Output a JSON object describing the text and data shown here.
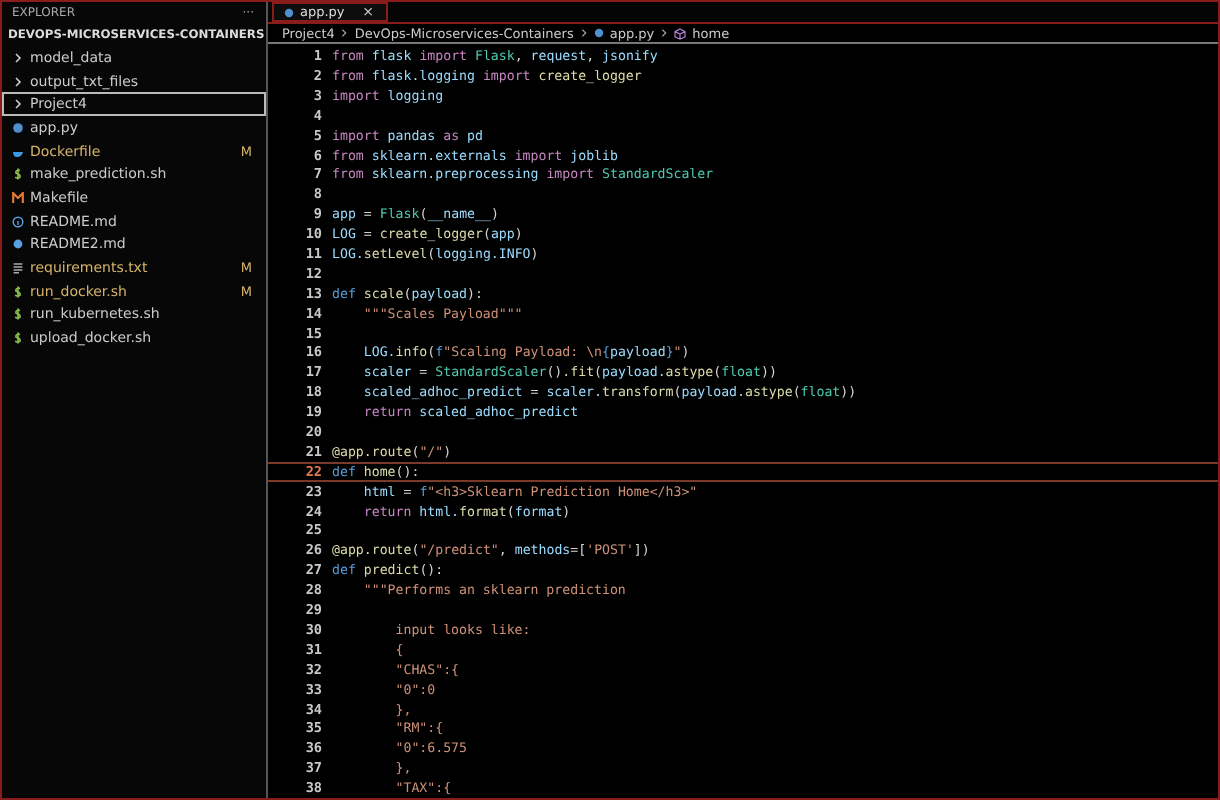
{
  "sidebar": {
    "header": "EXPLORER",
    "more": "···",
    "section": "DEVOPS-MICROSERVICES-CONTAINERS",
    "items": [
      {
        "kind": "folder",
        "label": "model_data",
        "selected": false,
        "modified": false
      },
      {
        "kind": "folder",
        "label": "output_txt_files",
        "selected": false,
        "modified": false
      },
      {
        "kind": "folder",
        "label": "Project4",
        "selected": true,
        "modified": false
      },
      {
        "kind": "python",
        "label": "app.py",
        "selected": false,
        "modified": false
      },
      {
        "kind": "docker",
        "label": "Dockerfile",
        "selected": false,
        "modified": true,
        "badge": "M"
      },
      {
        "kind": "shell",
        "label": "make_prediction.sh",
        "selected": false,
        "modified": false
      },
      {
        "kind": "make",
        "label": "Makefile",
        "selected": false,
        "modified": false
      },
      {
        "kind": "info",
        "label": "README.md",
        "selected": false,
        "modified": false
      },
      {
        "kind": "markdown",
        "label": "README2.md",
        "selected": false,
        "modified": false
      },
      {
        "kind": "text",
        "label": "requirements.txt",
        "selected": false,
        "modified": true,
        "badge": "M"
      },
      {
        "kind": "shell",
        "label": "run_docker.sh",
        "selected": false,
        "modified": true,
        "badge": "M"
      },
      {
        "kind": "shell",
        "label": "run_kubernetes.sh",
        "selected": false,
        "modified": false
      },
      {
        "kind": "shell",
        "label": "upload_docker.sh",
        "selected": false,
        "modified": false
      }
    ]
  },
  "tabs": [
    {
      "label": "app.py",
      "close": "×",
      "selected": true
    }
  ],
  "breadcrumb": [
    {
      "kind": "text",
      "label": "Project4"
    },
    {
      "kind": "text",
      "label": "DevOps-Microservices-Containers"
    },
    {
      "kind": "file",
      "label": "app.py"
    },
    {
      "kind": "symbol",
      "label": "home"
    }
  ],
  "lines": [
    {
      "number": "1",
      "current": false,
      "tokens": [
        {
          "kind": "kw",
          "text": "from "
        },
        {
          "kind": "var",
          "text": "flask "
        },
        {
          "kind": "kw",
          "text": "import "
        },
        {
          "kind": "cls",
          "text": "Flask"
        },
        {
          "kind": "punc",
          "text": ", "
        },
        {
          "kind": "var",
          "text": "request"
        },
        {
          "kind": "punc",
          "text": ", "
        },
        {
          "kind": "var",
          "text": "jsonify"
        }
      ]
    },
    {
      "number": "2",
      "current": false,
      "tokens": [
        {
          "kind": "kw",
          "text": "from "
        },
        {
          "kind": "var",
          "text": "flask.logging "
        },
        {
          "kind": "kw",
          "text": "import "
        },
        {
          "kind": "fn",
          "text": "create_logger"
        }
      ]
    },
    {
      "number": "3",
      "current": false,
      "tokens": [
        {
          "kind": "kw",
          "text": "import "
        },
        {
          "kind": "var",
          "text": "logging"
        }
      ]
    },
    {
      "number": "4",
      "current": false
    },
    {
      "number": "5",
      "current": false,
      "tokens": [
        {
          "kind": "kw",
          "text": "import "
        },
        {
          "kind": "var",
          "text": "pandas "
        },
        {
          "kind": "kw",
          "text": "as "
        },
        {
          "kind": "var",
          "text": "pd"
        }
      ]
    },
    {
      "number": "6",
      "current": false,
      "tokens": [
        {
          "kind": "kw",
          "text": "from "
        },
        {
          "kind": "var",
          "text": "sklearn.externals "
        },
        {
          "kind": "kw",
          "text": "import "
        },
        {
          "kind": "var",
          "text": "joblib"
        }
      ]
    },
    {
      "number": "7",
      "current": false,
      "tokens": [
        {
          "kind": "kw",
          "text": "from "
        },
        {
          "kind": "var",
          "text": "sklearn.preprocessing "
        },
        {
          "kind": "kw",
          "text": "import "
        },
        {
          "kind": "cls",
          "text": "StandardScaler"
        }
      ]
    },
    {
      "number": "8",
      "current": false
    },
    {
      "number": "9",
      "current": false,
      "tokens": [
        {
          "kind": "var",
          "text": "app "
        },
        {
          "kind": "punc",
          "text": "= "
        },
        {
          "kind": "cls",
          "text": "Flask"
        },
        {
          "kind": "punc",
          "text": "("
        },
        {
          "kind": "var",
          "text": "__name__"
        },
        {
          "kind": "punc",
          "text": ")"
        }
      ]
    },
    {
      "number": "10",
      "current": false,
      "tokens": [
        {
          "kind": "var",
          "text": "LOG "
        },
        {
          "kind": "punc",
          "text": "= "
        },
        {
          "kind": "fn",
          "text": "create_logger"
        },
        {
          "kind": "punc",
          "text": "("
        },
        {
          "kind": "var",
          "text": "app"
        },
        {
          "kind": "punc",
          "text": ")"
        }
      ]
    },
    {
      "number": "11",
      "current": false,
      "tokens": [
        {
          "kind": "var",
          "text": "LOG."
        },
        {
          "kind": "fn",
          "text": "setLevel"
        },
        {
          "kind": "punc",
          "text": "("
        },
        {
          "kind": "var",
          "text": "logging.INFO"
        },
        {
          "kind": "punc",
          "text": ")"
        }
      ]
    },
    {
      "number": "12",
      "current": false
    },
    {
      "number": "13",
      "current": false,
      "tokens": [
        {
          "kind": "def",
          "text": "def "
        },
        {
          "kind": "fn",
          "text": "scale"
        },
        {
          "kind": "punc",
          "text": "("
        },
        {
          "kind": "var",
          "text": "payload"
        },
        {
          "kind": "punc",
          "text": "):"
        }
      ]
    },
    {
      "number": "14",
      "current": false,
      "tokens": [
        {
          "kind": "str",
          "text": "    \"\"\"Scales Payload\"\"\""
        }
      ]
    },
    {
      "number": "15",
      "current": false
    },
    {
      "number": "16",
      "current": false,
      "tokens": [
        {
          "kind": "var",
          "text": "    LOG."
        },
        {
          "kind": "fn",
          "text": "info"
        },
        {
          "kind": "punc",
          "text": "("
        },
        {
          "kind": "def",
          "text": "f"
        },
        {
          "kind": "str",
          "text": "\"Scaling Payload: \\n"
        },
        {
          "kind": "def",
          "text": "{"
        },
        {
          "kind": "var",
          "text": "payload"
        },
        {
          "kind": "def",
          "text": "}"
        },
        {
          "kind": "str",
          "text": "\""
        },
        {
          "kind": "punc",
          "text": ")"
        }
      ]
    },
    {
      "number": "17",
      "current": false,
      "tokens": [
        {
          "kind": "var",
          "text": "    scaler "
        },
        {
          "kind": "punc",
          "text": "= "
        },
        {
          "kind": "cls",
          "text": "StandardScaler"
        },
        {
          "kind": "punc",
          "text": "()."
        },
        {
          "kind": "fn",
          "text": "fit"
        },
        {
          "kind": "punc",
          "text": "("
        },
        {
          "kind": "var",
          "text": "payload."
        },
        {
          "kind": "fn",
          "text": "astype"
        },
        {
          "kind": "punc",
          "text": "("
        },
        {
          "kind": "cls",
          "text": "float"
        },
        {
          "kind": "punc",
          "text": "))"
        }
      ]
    },
    {
      "number": "18",
      "current": false,
      "tokens": [
        {
          "kind": "var",
          "text": "    scaled_adhoc_predict "
        },
        {
          "kind": "punc",
          "text": "= "
        },
        {
          "kind": "var",
          "text": "scaler."
        },
        {
          "kind": "fn",
          "text": "transform"
        },
        {
          "kind": "punc",
          "text": "("
        },
        {
          "kind": "var",
          "text": "payload."
        },
        {
          "kind": "fn",
          "text": "astype"
        },
        {
          "kind": "punc",
          "text": "("
        },
        {
          "kind": "cls",
          "text": "float"
        },
        {
          "kind": "punc",
          "text": "))"
        }
      ]
    },
    {
      "number": "19",
      "current": false,
      "tokens": [
        {
          "kind": "kw",
          "text": "    return "
        },
        {
          "kind": "var",
          "text": "scaled_adhoc_predict"
        }
      ]
    },
    {
      "number": "20",
      "current": false
    },
    {
      "number": "21",
      "current": false,
      "tokens": [
        {
          "kind": "fn",
          "text": "@app.route"
        },
        {
          "kind": "punc",
          "text": "("
        },
        {
          "kind": "str",
          "text": "\"/\""
        },
        {
          "kind": "punc",
          "text": ")"
        }
      ]
    },
    {
      "number": "22",
      "current": true,
      "tokens": [
        {
          "kind": "def",
          "text": "def "
        },
        {
          "kind": "fn",
          "text": "home"
        },
        {
          "kind": "punc",
          "text": "():"
        }
      ]
    },
    {
      "number": "23",
      "current": false,
      "tokens": [
        {
          "kind": "var",
          "text": "    html "
        },
        {
          "kind": "punc",
          "text": "= "
        },
        {
          "kind": "def",
          "text": "f"
        },
        {
          "kind": "str",
          "text": "\"<h3>Sklearn Prediction Home</h3>\""
        }
      ]
    },
    {
      "number": "24",
      "current": false,
      "tokens": [
        {
          "kind": "kw",
          "text": "    return "
        },
        {
          "kind": "var",
          "text": "html."
        },
        {
          "kind": "fn",
          "text": "format"
        },
        {
          "kind": "punc",
          "text": "("
        },
        {
          "kind": "var",
          "text": "format"
        },
        {
          "kind": "punc",
          "text": ")"
        }
      ]
    },
    {
      "number": "25",
      "current": false
    },
    {
      "number": "26",
      "current": false,
      "tokens": [
        {
          "kind": "fn",
          "text": "@app.route"
        },
        {
          "kind": "punc",
          "text": "("
        },
        {
          "kind": "str",
          "text": "\"/predict\""
        },
        {
          "kind": "punc",
          "text": ", "
        },
        {
          "kind": "var",
          "text": "methods"
        },
        {
          "kind": "punc",
          "text": "=["
        },
        {
          "kind": "str",
          "text": "'POST'"
        },
        {
          "kind": "punc",
          "text": "])"
        }
      ]
    },
    {
      "number": "27",
      "current": false,
      "tokens": [
        {
          "kind": "def",
          "text": "def "
        },
        {
          "kind": "fn",
          "text": "predict"
        },
        {
          "kind": "punc",
          "text": "():"
        }
      ]
    },
    {
      "number": "28",
      "current": false,
      "tokens": [
        {
          "kind": "str",
          "text": "    \"\"\"Performs an sklearn prediction"
        }
      ]
    },
    {
      "number": "29",
      "current": false
    },
    {
      "number": "30",
      "current": false,
      "tokens": [
        {
          "kind": "str",
          "text": "        input looks like:"
        }
      ]
    },
    {
      "number": "31",
      "current": false,
      "tokens": [
        {
          "kind": "str",
          "text": "        {"
        }
      ]
    },
    {
      "number": "32",
      "current": false,
      "tokens": [
        {
          "kind": "str",
          "text": "        \"CHAS\":{"
        }
      ]
    },
    {
      "number": "33",
      "current": false,
      "tokens": [
        {
          "kind": "str",
          "text": "        \"0\":0"
        }
      ]
    },
    {
      "number": "34",
      "current": false,
      "tokens": [
        {
          "kind": "str",
          "text": "        },"
        }
      ]
    },
    {
      "number": "35",
      "current": false,
      "tokens": [
        {
          "kind": "str",
          "text": "        \"RM\":{"
        }
      ]
    },
    {
      "number": "36",
      "current": false,
      "tokens": [
        {
          "kind": "str",
          "text": "        \"0\":6.575"
        }
      ]
    },
    {
      "number": "37",
      "current": false,
      "tokens": [
        {
          "kind": "str",
          "text": "        },"
        }
      ]
    },
    {
      "number": "38",
      "current": false,
      "tokens": [
        {
          "kind": "str",
          "text": "        \"TAX\":{"
        }
      ]
    }
  ]
}
